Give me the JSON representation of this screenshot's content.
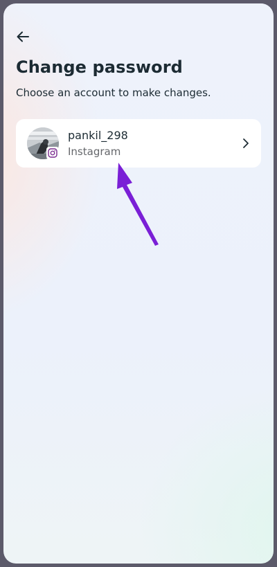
{
  "header": {
    "back_icon": "arrow-left-icon",
    "title": "Change password",
    "subtitle": "Choose an account to make changes."
  },
  "accounts": [
    {
      "username": "pankil_298",
      "platform": "Instagram",
      "badge_icon": "instagram-icon",
      "chevron_icon": "chevron-right-icon"
    }
  ],
  "annotation": {
    "arrow_color": "#7a1fd6"
  }
}
